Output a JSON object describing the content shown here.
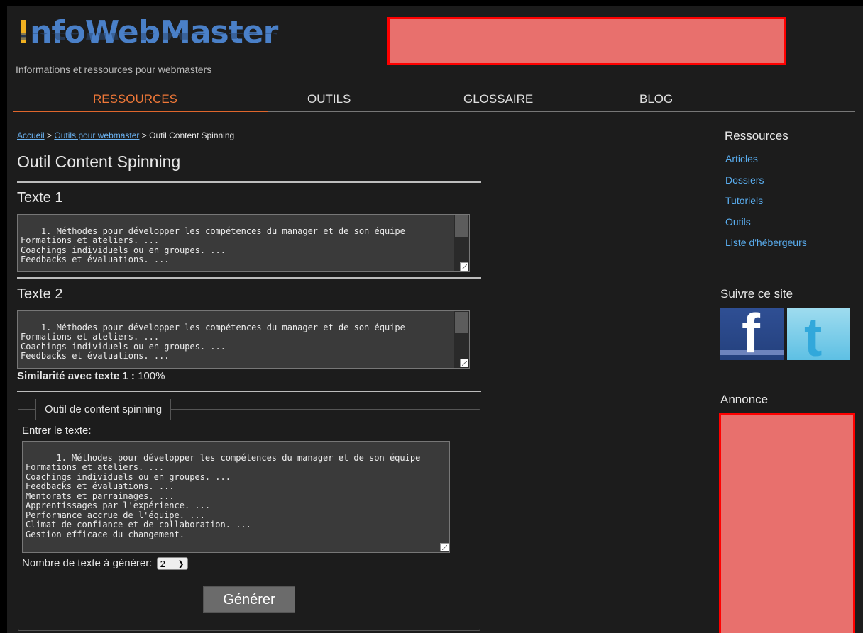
{
  "header": {
    "logo_bang": "!",
    "logo_text": "nfoWebMaster",
    "tagline": "Informations et ressources pour webmasters",
    "ad_color": "#e8706d"
  },
  "nav": {
    "items": [
      {
        "label": "RESSOURCES",
        "active": true
      },
      {
        "label": "OUTILS",
        "active": false
      },
      {
        "label": "GLOSSAIRE",
        "active": false
      },
      {
        "label": "BLOG",
        "active": false
      }
    ],
    "accent_color": "#f07838"
  },
  "breadcrumb": {
    "home": "Accueil",
    "sep1": " > ",
    "tools": "Outils pour webmaster",
    "sep2": " > ",
    "current": "Outil Content Spinning"
  },
  "main": {
    "title": "Outil Content Spinning",
    "texte1": {
      "heading": "Texte 1",
      "value": "1. Méthodes pour développer les compétences du manager et de son équipe\nFormations et ateliers. ...\nCoachings individuels ou en groupes. ...\nFeedbacks et évaluations. ..."
    },
    "texte2": {
      "heading": "Texte 2",
      "value": "1. Méthodes pour développer les compétences du manager et de son équipe\nFormations et ateliers. ...\nCoachings individuels ou en groupes. ...\nFeedbacks et évaluations. ..."
    },
    "similarity": {
      "label": "Similarité avec texte 1 :",
      "value": " 100%"
    },
    "spinner": {
      "legend": "Outil de content spinning",
      "input_label": "Entrer le texte:",
      "input_value": "1. Méthodes pour développer les compétences du manager et de son équipe\nFormations et ateliers. ...\nCoachings individuels ou en groupes. ...\nFeedbacks et évaluations. ...\nMentorats et parrainages. ...\nApprentissages par l'expérience. ...\nPerformance accrue de l'équipe. ...\nClimat de confiance et de collaboration. ...\nGestion efficace du changement.",
      "count_label": "Nombre de texte à générer:",
      "count_value": "2",
      "generate_label": "Générer"
    }
  },
  "sidebar": {
    "resources_title": "Ressources",
    "links": [
      "Articles",
      "Dossiers",
      "Tutoriels",
      "Outils",
      "Liste d'hébergeurs"
    ],
    "follow_title": "Suivre ce site",
    "social": [
      "facebook-icon",
      "twitter-icon"
    ],
    "ad_title": "Annonce",
    "link_color": "#5aaef0"
  }
}
